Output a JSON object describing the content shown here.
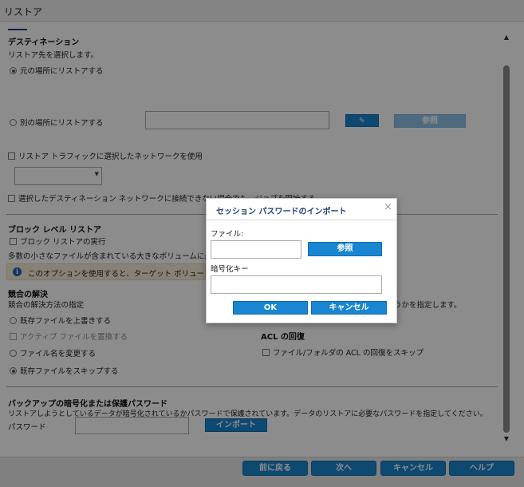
{
  "window": {
    "title": "リストア"
  },
  "destination": {
    "heading": "デスティネーション",
    "description": "リストア先を選択します。",
    "original_location": "元の場所にリストアする",
    "other_location": "別の場所にリストアする",
    "other_location_path": "",
    "browse_button": "参照",
    "use_network": "リストア トラフィックに選択したネットワークを使用",
    "network_selected": "",
    "start_job_option": "選択したデスティネーション ネットワークに接続できない場合でも、ジョブを開始する"
  },
  "block_level": {
    "heading": "ブロック レベル リストア",
    "run_option": "ブロック リストアの実行",
    "description": "多数の小さなファイルが含まれている大きなボリュームに最適です",
    "info": "このオプションを使用すると、ターゲット ボリュー"
  },
  "conflict": {
    "heading": "競合の解決",
    "description": "競合の解決方法の指定",
    "right_description": "うかを指定します。",
    "options": [
      "既存ファイルを上書きする",
      "アクティブ ファイルを置換する",
      "ファイル名を変更する",
      "既存ファイルをスキップする"
    ],
    "selected_index": 3,
    "acl_heading": "ACL の回復",
    "acl_skip": "ファイル/フォルダの ACL の回復をスキップ"
  },
  "encryption": {
    "heading": "バックアップの暗号化または保護パスワード",
    "description": "リストアしようとしているデータが暗号化されているかパスワードで保護されています。データのリストアに必要なパスワードを指定してください。",
    "password_label": "パスワード",
    "password_value": "",
    "import_button": "インポート"
  },
  "footer": {
    "back": "前に戻る",
    "next": "次へ",
    "cancel": "キャンセル",
    "help": "ヘルプ"
  },
  "dialog": {
    "title": "セッション パスワードのインポート",
    "file_label": "ファイル:",
    "file_value": "",
    "browse_button": "参照",
    "key_label": "暗号化キー",
    "key_value": "",
    "ok_button": "OK",
    "cancel_button": "キャンセル"
  },
  "colors": {
    "button_blue": "#1a85d0",
    "title_blue": "#1f3f7a",
    "overlay": "rgba(0,0,0,0.45)"
  }
}
